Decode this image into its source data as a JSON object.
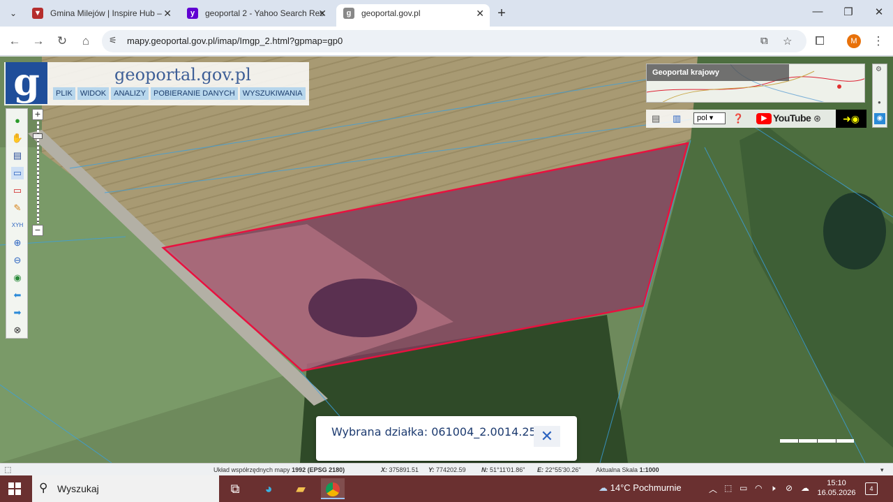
{
  "browser": {
    "tabs": [
      {
        "title": "Gmina Milejów | Inspire Hub – ",
        "icon": "inspire-hub-icon",
        "color": "#b52d2d",
        "active": false
      },
      {
        "title": "geoportal 2 - Yahoo Search Res",
        "icon": "yahoo-icon",
        "color": "#6001d2",
        "active": false
      },
      {
        "title": "geoportal.gov.pl",
        "icon": "geoportal-icon",
        "color": "#888888",
        "active": true
      }
    ],
    "url": "mapy.geoportal.gov.pl/imap/Imgp_2.html?gpmap=gp0",
    "profile_initial": "M"
  },
  "app": {
    "logo_letter": "g",
    "logo_title": "geoportal.gov.pl",
    "menu": [
      "PLIK",
      "WIDOK",
      "ANALIZY",
      "POBIERANIE DANYCH",
      "WYSZUKIWANIA"
    ],
    "overview_title": "Geoportal krajowy",
    "language": "pol",
    "youtube_label": "YouTube",
    "selected_parcel_label": "Wybrana działka: 061004_2.0014.257",
    "highlight_color": "#e8113f"
  },
  "status": {
    "crs_label": "Układ współrzędnych mapy",
    "crs_value": "1992 (EPSG 2180)",
    "x_label": "X:",
    "x_value": "375891.51",
    "y_label": "Y:",
    "y_value": "774202.59",
    "n_label": "N:",
    "n_value": "51°11'01.86\"",
    "e_label": "E:",
    "e_value": "22°55'30.26\"",
    "scale_label": "Aktualna Skala",
    "scale_value": "1:1000"
  },
  "taskbar": {
    "search_placeholder": "Wyszukaj",
    "weather": "14°C  Pochmurnie",
    "time": "15:10",
    "date": "16.05.2026",
    "notifications": "4"
  }
}
